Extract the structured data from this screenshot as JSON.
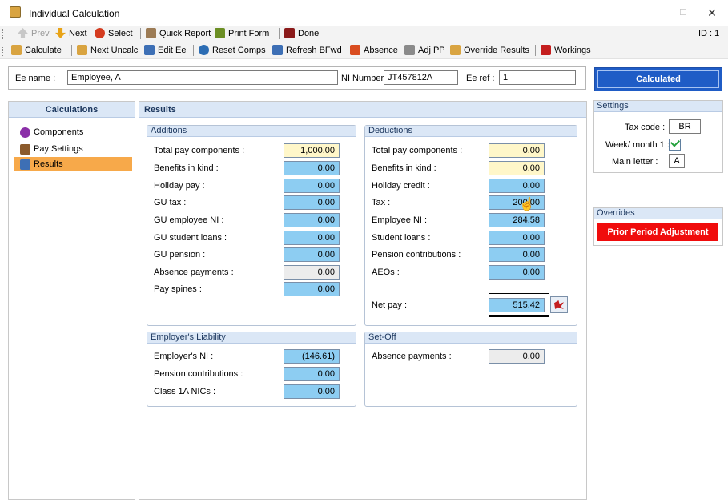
{
  "window": {
    "title": "Individual Calculation",
    "min": "–",
    "max": "☐",
    "close": "✕",
    "id_label": "ID : 1"
  },
  "toolbar1": [
    {
      "key": "prev",
      "label": "Prev",
      "icon": "up-arrow-icon",
      "color": "#b0b0b0",
      "disabled": true
    },
    {
      "key": "next",
      "label": "Next",
      "icon": "down-arrow-icon",
      "color": "#e8a317"
    },
    {
      "key": "select",
      "label": "Select",
      "icon": "select-icon",
      "color": "#d43b1f"
    },
    {
      "key": "quick_report",
      "label": "Quick Report",
      "icon": "report-icon",
      "color": "#7a5c3a"
    },
    {
      "key": "print_form",
      "label": "Print Form",
      "icon": "print-icon",
      "color": "#6b8e23"
    },
    {
      "key": "done",
      "label": "Done",
      "icon": "exit-icon",
      "color": "#8b1a1a"
    }
  ],
  "toolbar2": [
    {
      "key": "calculate",
      "label": "Calculate",
      "icon": "calculator-icon",
      "color": "#d9a441"
    },
    {
      "key": "next_uncalc",
      "label": "Next Uncalc",
      "icon": "calculator-icon",
      "color": "#d9a441"
    },
    {
      "key": "edit_ee",
      "label": "Edit Ee",
      "icon": "edit-employee-icon",
      "color": "#3d6fb5"
    },
    {
      "key": "reset_comps",
      "label": "Reset Comps",
      "icon": "reset-icon",
      "color": "#2c6db4"
    },
    {
      "key": "refresh_bfwd",
      "label": "Refresh BFwd",
      "icon": "refresh-icon",
      "color": "#3d6fb5"
    },
    {
      "key": "absence",
      "label": "Absence",
      "icon": "absence-icon",
      "color": "#d94c1f"
    },
    {
      "key": "adj_pp",
      "label": "Adj PP",
      "icon": "adjust-icon",
      "color": "#8a8a8a"
    },
    {
      "key": "override_results",
      "label": "Override Results",
      "icon": "calculator-icon",
      "color": "#d9a441"
    },
    {
      "key": "workings",
      "label": "Workings",
      "icon": "workings-icon",
      "color": "#c41e1e"
    }
  ],
  "header": {
    "ee_name_label": "Ee name :",
    "ee_name": "Employee, A",
    "ni_label": "NI Number :",
    "ni_number": "JT457812A",
    "ee_ref_label": "Ee ref :",
    "ee_ref": "1"
  },
  "leftnav": {
    "title": "Calculations",
    "items": [
      {
        "label": "Components",
        "icon": "components-icon",
        "color": "#8b2fa8"
      },
      {
        "label": "Pay Settings",
        "icon": "pay-settings-icon",
        "color": "#8b5a2b"
      },
      {
        "label": "Results",
        "icon": "results-icon",
        "color": "#3d6fb5",
        "selected": true
      }
    ]
  },
  "results": {
    "title": "Results",
    "additions": {
      "title": "Additions",
      "rows": [
        {
          "label": "Total pay components :",
          "value": "1,000.00",
          "style": "yellow"
        },
        {
          "label": "Benefits in kind :",
          "value": "0.00",
          "style": "blue"
        },
        {
          "label": "Holiday pay :",
          "value": "0.00",
          "style": "blue"
        },
        {
          "label": "GU tax :",
          "value": "0.00",
          "style": "blue"
        },
        {
          "label": "GU employee NI :",
          "value": "0.00",
          "style": "blue"
        },
        {
          "label": "GU student loans :",
          "value": "0.00",
          "style": "blue"
        },
        {
          "label": "GU pension :",
          "value": "0.00",
          "style": "blue"
        },
        {
          "label": "Absence payments :",
          "value": "0.00",
          "style": "grey"
        },
        {
          "label": "Pay spines :",
          "value": "0.00",
          "style": "blue"
        }
      ]
    },
    "deductions": {
      "title": "Deductions",
      "rows": [
        {
          "label": "Total pay components :",
          "value": "0.00",
          "style": "yellow"
        },
        {
          "label": "Benefits in kind :",
          "value": "0.00",
          "style": "yellow"
        },
        {
          "label": "Holiday credit :",
          "value": "0.00",
          "style": "blue"
        },
        {
          "label": "Tax :",
          "value": "200.00",
          "style": "blue"
        },
        {
          "label": "Employee NI :",
          "value": "284.58",
          "style": "blue"
        },
        {
          "label": "Student loans :",
          "value": "0.00",
          "style": "blue"
        },
        {
          "label": "Pension contributions :",
          "value": "0.00",
          "style": "blue"
        },
        {
          "label": "AEOs :",
          "value": "0.00",
          "style": "blue"
        }
      ],
      "net_pay_label": "Net pay :",
      "net_pay": "515.42"
    },
    "employers_liability": {
      "title": "Employer's Liability",
      "rows": [
        {
          "label": "Employer's NI :",
          "value": "(146.61)",
          "style": "blue"
        },
        {
          "label": "Pension contributions :",
          "value": "0.00",
          "style": "blue"
        },
        {
          "label": "Class 1A NICs :",
          "value": "0.00",
          "style": "blue"
        }
      ]
    },
    "set_off": {
      "title": "Set-Off",
      "rows": [
        {
          "label": "Absence payments :",
          "value": "0.00",
          "style": "grey"
        }
      ]
    }
  },
  "status_button": "Calculated",
  "settings": {
    "title": "Settings",
    "tax_code_label": "Tax code :",
    "tax_code": "BR",
    "week1_label": "Week/ month 1 :",
    "week1_checked": true,
    "main_letter_label": "Main letter :",
    "main_letter": "A"
  },
  "overrides": {
    "title": "Overrides",
    "button": "Prior Period Adjustment"
  },
  "colors": {
    "accent_blue": "#1f5cc6",
    "field_blue": "#8dcdf2",
    "field_yellow": "#fff7c9",
    "selected_nav": "#f7a94a",
    "override_red": "#f00c0c"
  }
}
